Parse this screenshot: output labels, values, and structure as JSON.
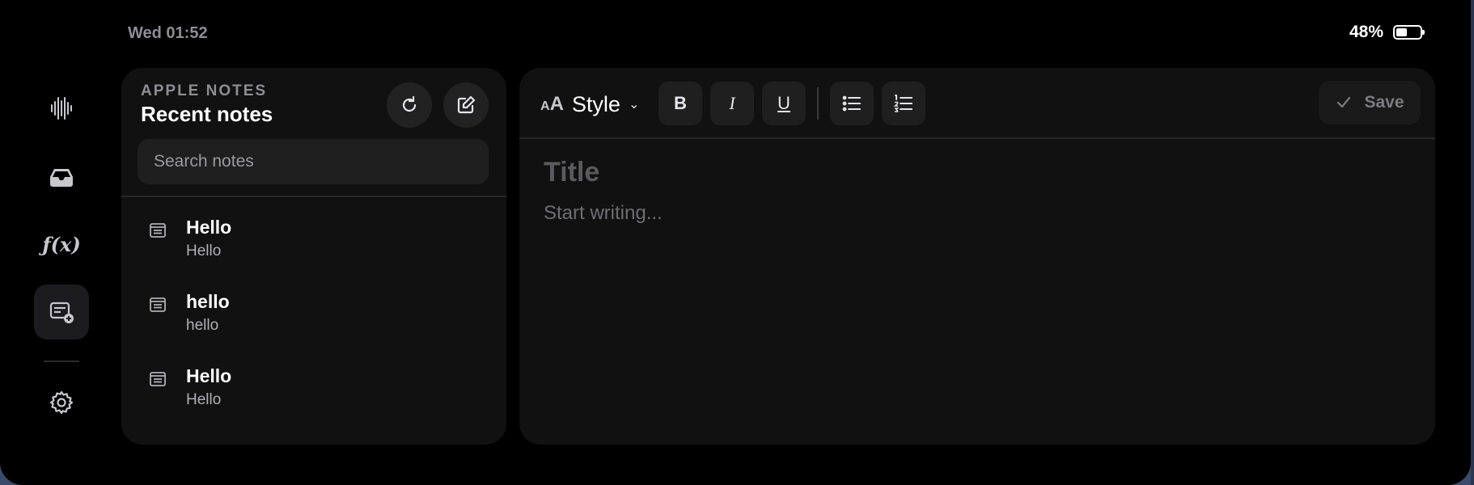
{
  "status_bar": {
    "time": "Wed 01:52",
    "battery_percent": "48%",
    "battery_level": 0.48
  },
  "rail": {
    "items": [
      {
        "name": "waveform-icon",
        "active": false
      },
      {
        "name": "inbox-tray-icon",
        "active": false
      },
      {
        "name": "function-fx-icon",
        "label": "ƒ(x)",
        "active": false
      },
      {
        "name": "note-add-icon",
        "active": true
      },
      {
        "name": "gear-icon",
        "active": false
      }
    ]
  },
  "notes_panel": {
    "app_name": "APPLE NOTES",
    "title": "Recent notes",
    "refresh_icon": "refresh-icon",
    "compose_icon": "compose-icon",
    "search": {
      "placeholder": "Search notes",
      "value": ""
    },
    "notes": [
      {
        "title": "Hello",
        "preview": "Hello"
      },
      {
        "title": "hello",
        "preview": "hello"
      },
      {
        "title": "Hello",
        "preview": "Hello"
      }
    ]
  },
  "editor": {
    "toolbar": {
      "style_label": "Style",
      "bold_label": "B",
      "italic_label": "I",
      "underline_label": "U",
      "save_label": "Save"
    },
    "title_placeholder": "Title",
    "body_placeholder": "Start writing..."
  }
}
